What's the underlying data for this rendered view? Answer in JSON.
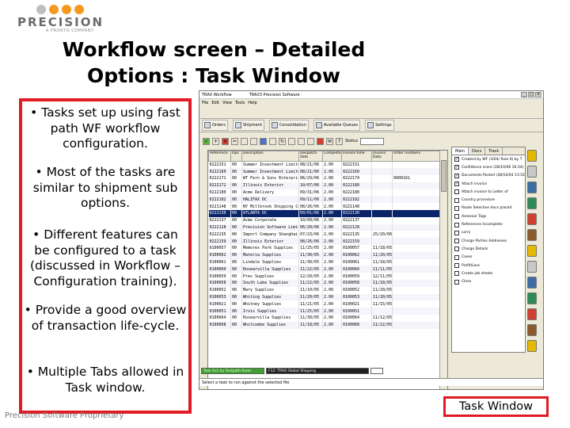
{
  "logo": {
    "word": "PRECISION",
    "tagline": "A PRONTO COMPANY",
    "dot_colors": [
      "#bfbfbf",
      "#f39a1e",
      "#f39a1e",
      "#f39a1e"
    ]
  },
  "title": {
    "line1": "Workflow screen – Detailed",
    "line2": "Options : Task Window"
  },
  "notes": [
    "• Tasks set up using fast path WF workflow configuration.",
    "• Most of the tasks are similar to shipment sub options.",
    "• Different features can be configured to a task (discussed in Workflow – Configuration training).",
    "• Provide a good overview of transaction life-cycle.",
    "• Multiple Tabs allowed in Task window."
  ],
  "footer": "Precision Software Proprietary",
  "caption": "Task Window",
  "colors": {
    "accent_red": "#e01b24",
    "selection": "#0a246a",
    "status_green": "#40a030"
  },
  "app": {
    "titlebar": {
      "left": "TRAX Workflow",
      "center": "TRAX3 Precision Software"
    },
    "window_buttons": [
      "_",
      "□",
      "x"
    ],
    "menu": [
      "File",
      "Edit",
      "View",
      "Tools",
      "Help"
    ],
    "ribbon": [
      "Orders",
      "Shipment",
      "Consolidation",
      "Available Queues",
      "Settings"
    ],
    "toolbar_icons": [
      "check-icon",
      "add-icon",
      "delete-icon",
      "cut-icon",
      "copy-icon",
      "paste-icon",
      "find-icon",
      "print-icon",
      "refresh-icon",
      "filter-icon",
      "sort-icon",
      "calendar-icon",
      "chart-icon",
      "email-icon",
      "help-icon"
    ],
    "toolbar_label": "Status",
    "grid": {
      "columns": [
        "Reference",
        "Ops",
        "Description",
        "Despatch date",
        "Complete",
        "Invoice time",
        "Invoice Date",
        "Order numbers"
      ],
      "rows": [
        [
          "0222151",
          "00",
          "Summer Investment Limited",
          "08/21/06",
          "2.00",
          "0222151",
          "",
          ""
        ],
        [
          "0222160",
          "00",
          "Summer Investment Limited",
          "08/21/06",
          "2.00",
          "0222160",
          "",
          ""
        ],
        [
          "0222171",
          "00",
          "WT Fern & Sons Enterprises",
          "06/29/06",
          "2.00",
          "0222174",
          "",
          "0000161"
        ],
        [
          "0222172",
          "00",
          "Illinois Exterior",
          "10/07/06",
          "2.00",
          "0222180",
          "",
          ""
        ],
        [
          "0222180",
          "00",
          "Acme Delivery",
          "09/31/06",
          "2.00",
          "0222180",
          "",
          ""
        ],
        [
          "0222182",
          "00",
          "HALIFAX DC",
          "09/11/06",
          "2.00",
          "0222182",
          "",
          ""
        ],
        [
          "0221148",
          "00",
          "NY Millbrook Shipping Co",
          "08/26/06",
          "2.00",
          "0221148",
          "",
          ""
        ],
        [
          "0222130",
          "00",
          "ATLANTA DC",
          "09/01/06",
          "2.00",
          "0222130",
          "",
          ""
        ],
        [
          "0222137",
          "00",
          "Acme Corporate",
          "10/09/06",
          "2.00",
          "0222137",
          "",
          ""
        ],
        [
          "0222128",
          "00",
          "Precision Software Limited",
          "06/20/06",
          "2.00",
          "0222128",
          "",
          ""
        ],
        [
          "0222135",
          "00",
          "Import Company Shanghai",
          "07/23/06",
          "2.00",
          "0222135",
          "25/20/06",
          ""
        ],
        [
          "0222159",
          "00",
          "Illinois Exterior",
          "08/26/06",
          "2.00",
          "0222159",
          "",
          ""
        ],
        [
          "0100057",
          "00",
          "Memorex Park Supplies",
          "11/25/05",
          "2.00",
          "0100057",
          "11/18/05",
          ""
        ],
        [
          "0100062",
          "00",
          "Materia Supplies",
          "11/30/05",
          "2.00",
          "0100062",
          "11/20/05",
          ""
        ],
        [
          "0100061",
          "00",
          "Lindale Supplies",
          "11/30/05",
          "2.00",
          "0100061",
          "11/18/05",
          ""
        ],
        [
          "0100060",
          "00",
          "Rosearvilla Supplies",
          "11/22/05",
          "2.00",
          "0100060",
          "11/11/05",
          ""
        ],
        [
          "0100059",
          "00",
          "Pres Supplies",
          "12/20/05",
          "2.00",
          "0100059",
          "12/11/05",
          ""
        ],
        [
          "0100058",
          "00",
          "South Lake Supplies",
          "11/22/05",
          "2.00",
          "0100058",
          "11/18/05",
          ""
        ],
        [
          "0100052",
          "00",
          "Mary Supplies",
          "11/10/05",
          "2.00",
          "0100052",
          "11/20/0500252",
          ""
        ],
        [
          "0100053",
          "00",
          "Whiting Supplies",
          "11/20/05",
          "2.00",
          "0100053",
          "11/20/0500253",
          ""
        ],
        [
          "0100021",
          "00",
          "Whitney Supplies",
          "11/21/05",
          "2.00",
          "0100021",
          "11/15/05",
          ""
        ],
        [
          "0100051",
          "00",
          "Irvis Supplies",
          "11/25/05",
          "2.00",
          "0100051",
          "",
          ""
        ],
        [
          "0100064",
          "00",
          "Rosearvilla Supplies",
          "11/30/05",
          "2.00",
          "0100064",
          "11/12/05",
          ""
        ],
        [
          "0100068",
          "00",
          "Whitcombe Supplies",
          "11/18/05",
          "2.00",
          "0100068",
          "11/22/05",
          ""
        ]
      ],
      "selected_row": 7
    },
    "task_panel": {
      "tabs": [
        "Main",
        "Docs",
        "Track"
      ],
      "items": [
        {
          "label": "Created by WF (3/04/ Rule 6) by T",
          "checked": true
        },
        {
          "label": "Confidence score (28/10/06 16:34)",
          "checked": true
        },
        {
          "label": "Documents Posted (28/10/04 13:52)",
          "checked": true
        },
        {
          "label": "Attach invoice",
          "checked": true
        },
        {
          "label": "Attach invoice to Letter of",
          "checked": false
        },
        {
          "label": "Country procedure",
          "checked": false
        },
        {
          "label": "Route Selective docs placed",
          "checked": false
        },
        {
          "label": "Assessor Tags",
          "checked": false
        },
        {
          "label": "References Incomplete",
          "checked": false
        },
        {
          "label": "Lorry",
          "checked": false
        },
        {
          "label": "Charge Parties Addresses",
          "checked": false
        },
        {
          "label": "Charge Details",
          "checked": false
        },
        {
          "label": "Cases",
          "checked": false
        },
        {
          "label": "Profit/Loss",
          "checked": false
        },
        {
          "label": "Create job sheets",
          "checked": false
        },
        {
          "label": "Close",
          "checked": false
        }
      ]
    },
    "side_icons": [
      "tag-icon",
      "folder-icon",
      "document-icon",
      "binder-icon",
      "box-icon",
      "stack-icon",
      "note-icon",
      "folder-open-icon",
      "drawer-icon",
      "trash-icon",
      "flag-icon",
      "key-icon",
      "pencil-icon"
    ],
    "status": {
      "left": "Task Ack by Fastpath Rules",
      "middle": "F12: TRAX  Global Shipping",
      "message": "Select a task to run against the selected file"
    }
  }
}
